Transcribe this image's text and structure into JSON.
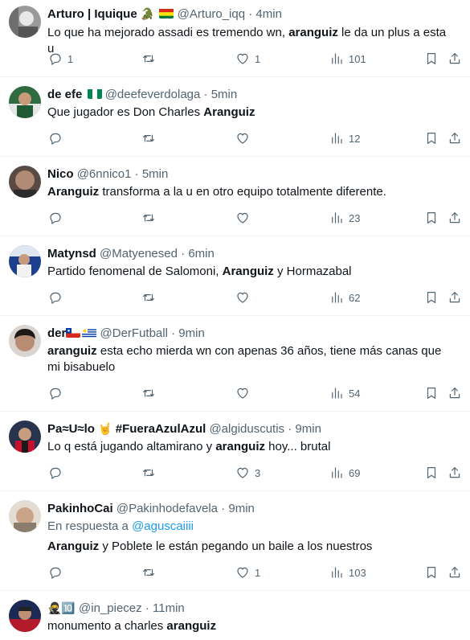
{
  "colors": {
    "text": "#0f1419",
    "muted": "#536471",
    "link": "#1d9bf0",
    "divider": "#eff3f4"
  },
  "tweets": [
    {
      "name": "Arturo | Iquique",
      "name_emoji": "🐊",
      "flag": "bolivia-flag-icon",
      "handle": "@Arturo_iqq",
      "sep": "·",
      "time": "4min",
      "text_pre": "Lo que ha mejorado assadi es tremendo wn, ",
      "text_bold": "aranguiz",
      "text_post": " le da un plus a esta u",
      "replies": "1",
      "retweets": "",
      "likes": "1",
      "views": "101"
    },
    {
      "name": "de efe",
      "flag": "nigeria-flag-icon",
      "handle": "@deefeverdolaga",
      "sep": "·",
      "time": "5min",
      "text_pre": "Que jugador es Don Charles ",
      "text_bold": "Aranguiz",
      "text_post": "",
      "replies": "",
      "retweets": "",
      "likes": "",
      "views": "12"
    },
    {
      "name": "Nico",
      "handle": "@6nnico1",
      "sep": "·",
      "time": "5min",
      "text_pre": "",
      "text_bold": "Aranguiz",
      "text_post": " transforma a la u en otro equipo totalmente diferente.",
      "replies": "",
      "retweets": "",
      "likes": "",
      "views": "23"
    },
    {
      "name": "Matynsd",
      "handle": "@Matyenesed",
      "sep": "·",
      "time": "6min",
      "text_pre": "Partido fenomenal de Salomoni, ",
      "text_bold": "Aranguiz",
      "text_post": " y Hormazabal",
      "replies": "",
      "retweets": "",
      "likes": "",
      "views": "62"
    },
    {
      "name": "der",
      "flags": [
        "chile-flag-icon",
        "uruguay-flag-icon"
      ],
      "handle": "@DerFutball",
      "sep": "·",
      "time": "9min",
      "text_pre": "",
      "text_bold": "aranguiz",
      "text_post": " esta echo mierda wn con apenas 36 años, tiene más canas que mi bisabuelo",
      "replies": "",
      "retweets": "",
      "likes": "",
      "views": "54"
    },
    {
      "name": "Pa≈U≈lo",
      "name_emoji": "🤘",
      "name_suffix": "#FueraAzulAzul",
      "handle": "@algiduscutis",
      "sep": "·",
      "time": "9min",
      "text_pre": "Lo q está jugando altamirano y ",
      "text_bold": "aranguiz",
      "text_post": " hoy... brutal",
      "replies": "",
      "retweets": "",
      "likes": "3",
      "views": "69"
    },
    {
      "name": "PakinhoCai",
      "handle": "@Pakinhodefavela",
      "sep": "·",
      "time": "9min",
      "reply_label": "En respuesta a",
      "reply_handle": "@aguscaiiii",
      "text_pre": "",
      "text_bold": "Aranguiz",
      "text_post": " y Poblete le están pegando un baile a los nuestros",
      "replies": "",
      "retweets": "",
      "likes": "1",
      "views": "103"
    },
    {
      "name": "🥷🔟",
      "handle": "@in_piecez",
      "sep": "·",
      "time": "11min",
      "text_pre": "monumento a charles ",
      "text_bold": "aranguiz",
      "text_post": "",
      "replies": "",
      "retweets": "",
      "likes": "",
      "views": ""
    }
  ]
}
